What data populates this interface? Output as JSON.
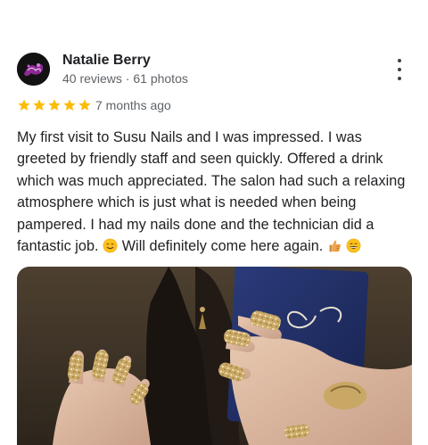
{
  "reviewer": {
    "name": "Natalie Berry",
    "meta": "40 reviews · 61 photos",
    "avatar_icon": "reviewer-avatar"
  },
  "review": {
    "rating": 5,
    "rating_max": 5,
    "time": "7 months ago",
    "text_lines": [
      "My first visit to Susu Nails and I was impressed. I was",
      "greeted by friendly staff and seen quickly. Offered a drink",
      "which was much appreciated. The salon had such a relaxing",
      "atmosphere which is just what is needed when being",
      "pampered. I had my nails done and the technician did a",
      "fantastic job.",
      "Will definitely come here again."
    ],
    "emoji": [
      "smiling-face-icon",
      "thumbs-up-icon",
      "grinning-face-icon"
    ]
  },
  "colors": {
    "star": "#fbbc04",
    "text": "#202124",
    "secondary": "#5f6368"
  },
  "icons": {
    "more": "more-vert-icon",
    "star": "star-icon"
  }
}
